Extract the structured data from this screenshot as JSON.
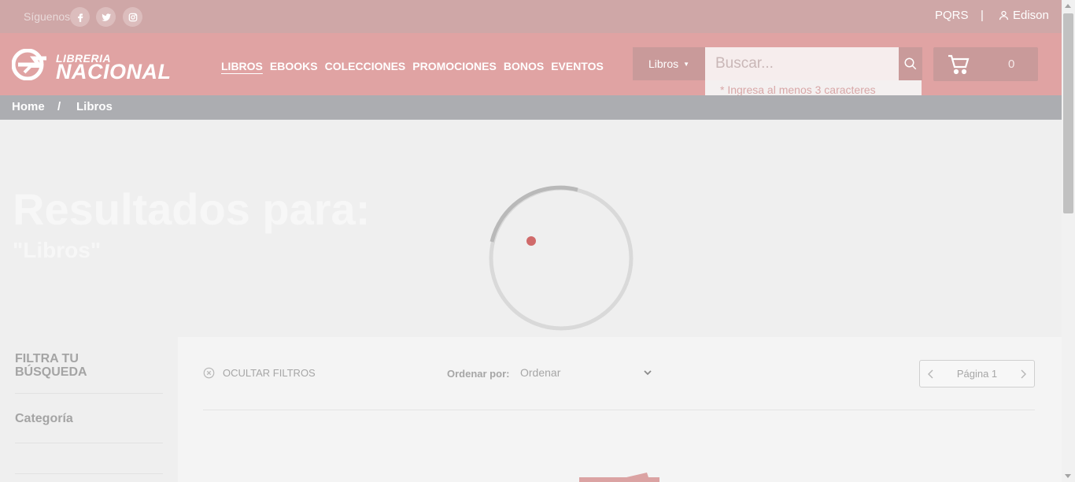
{
  "topbar": {
    "follow_label": "Síguenos",
    "social": [
      "facebook-icon",
      "twitter-icon",
      "instagram-icon"
    ],
    "pqrs": "PQRS",
    "separator": "|",
    "user_name": "Edison"
  },
  "header": {
    "logo_top": "LIBRERIA",
    "logo_bottom": "NACIONAL",
    "nav": [
      {
        "label": "LIBROS",
        "active": true
      },
      {
        "label": "EBOOKS"
      },
      {
        "label": "COLECCIONES"
      },
      {
        "label": "PROMOCIONES"
      },
      {
        "label": "BONOS"
      },
      {
        "label": "EVENTOS"
      }
    ],
    "search_category": "Libros",
    "search_placeholder": "Buscar...",
    "search_hint": "* Ingresa al menos 3 caracteres",
    "cart_count": "0"
  },
  "breadcrumb": {
    "home": "Home",
    "separator": "/",
    "current": "Libros"
  },
  "hero": {
    "title": "Resultados para:",
    "query": "\"Libros\""
  },
  "sidebar": {
    "title": "FILTRA TU BÚSQUEDA",
    "category_label": "Categoría"
  },
  "toolbar": {
    "hide_filters": "OCULTAR FILTROS",
    "order_label": "Ordenar por:",
    "order_value": "Ordenar",
    "page_label": "Página 1"
  },
  "colors": {
    "topbar": "#cfa7a7",
    "header": "#e0a3a3",
    "breadcrumb": "#acadb1",
    "spinner_dot": "#d06a6a"
  }
}
